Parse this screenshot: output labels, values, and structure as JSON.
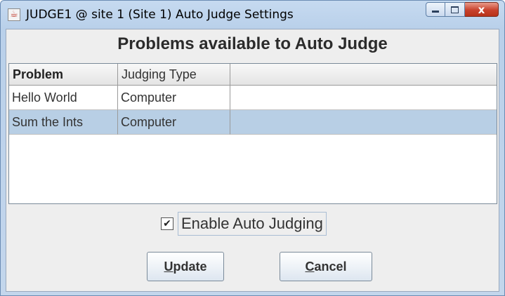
{
  "window": {
    "title": "JUDGE1 @ site 1 (Site 1) Auto Judge Settings",
    "controls": {
      "minimize": "",
      "maximize": "",
      "close": "x"
    }
  },
  "heading": "Problems available to Auto Judge",
  "table": {
    "columns": [
      "Problem",
      "Judging Type",
      ""
    ],
    "rows": [
      {
        "problem": "Hello World",
        "type": "Computer",
        "extra": "",
        "selected": false
      },
      {
        "problem": "Sum the Ints",
        "type": "Computer",
        "extra": "",
        "selected": true
      }
    ]
  },
  "auto_judging": {
    "label": "Enable Auto Judging",
    "checked": true,
    "check_glyph": "✔"
  },
  "buttons": {
    "update": {
      "mnemonic": "U",
      "rest": "pdate"
    },
    "cancel": {
      "mnemonic": "C",
      "rest": "ancel"
    }
  },
  "colors": {
    "selection": "#b8cfe5",
    "close_button": "#c8412c"
  }
}
